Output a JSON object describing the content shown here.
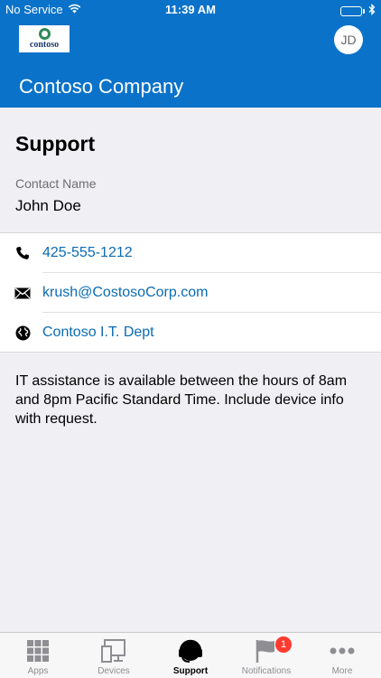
{
  "status_bar": {
    "carrier": "No Service",
    "time": "11:39 AM",
    "wifi_icon": "wifi-icon",
    "bluetooth_icon": "bluetooth-icon",
    "battery_icon": "battery-icon",
    "battery_level": 1.0
  },
  "header": {
    "logo_text": "contoso",
    "avatar_initials": "JD",
    "title": "Contoso Company"
  },
  "page": {
    "title": "Support",
    "contact_label": "Contact Name",
    "contact_name": "John Doe"
  },
  "contacts": [
    {
      "icon": "phone-icon",
      "text": "425-555-1212"
    },
    {
      "icon": "mail-icon",
      "text": "krush@CostosoCorp.com"
    },
    {
      "icon": "globe-icon",
      "text": "Contoso I.T. Dept"
    }
  ],
  "info_text": "IT assistance is available between the hours of 8am and 8pm Pacific Standard Time.  Include device info with request.",
  "tabbar": {
    "tabs": [
      {
        "label": "Apps",
        "icon": "apps-grid-icon"
      },
      {
        "label": "Devices",
        "icon": "devices-icon"
      },
      {
        "label": "Support",
        "icon": "headset-icon",
        "active": true
      },
      {
        "label": "Notifications",
        "icon": "flag-icon",
        "badge": "1"
      },
      {
        "label": "More",
        "icon": "more-dots-icon"
      }
    ]
  },
  "colors": {
    "brand_blue": "#0a72c9",
    "link_blue": "#0b6bb3",
    "badge_red": "#ff3b30"
  }
}
